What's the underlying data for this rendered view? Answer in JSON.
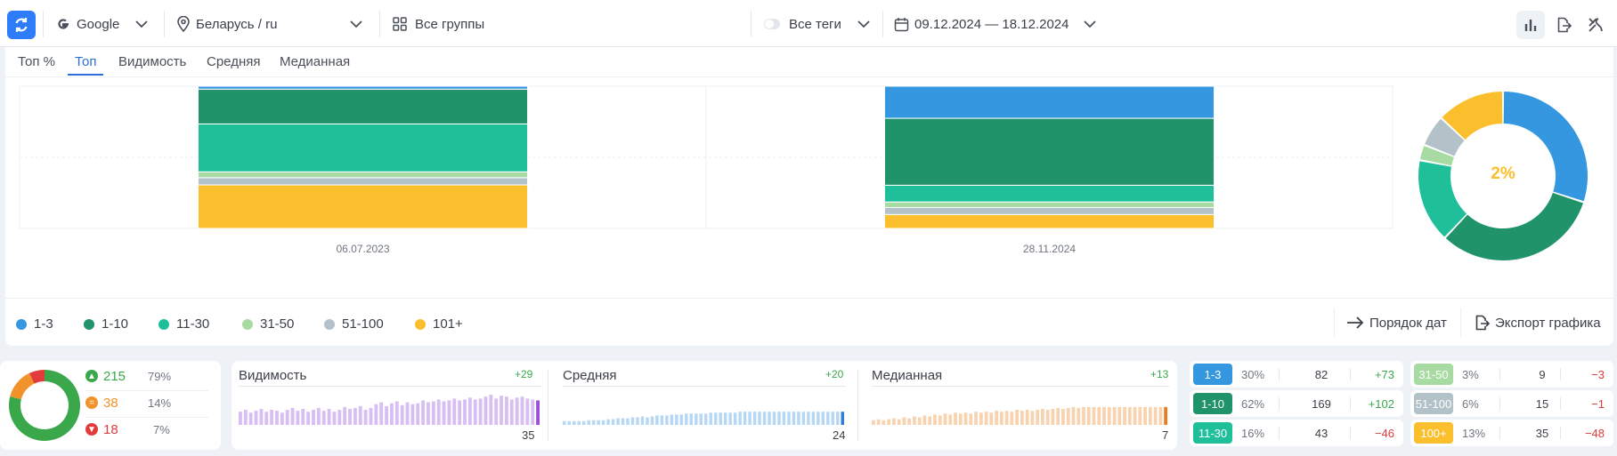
{
  "toolbar": {
    "engine": "Google",
    "region": "Беларусь / ru",
    "groups": "Все группы",
    "tags": "Все теги",
    "date_range": "09.12.2024 — 18.12.2024"
  },
  "tabs": [
    {
      "label": "Топ %",
      "active": false
    },
    {
      "label": "Топ",
      "active": true
    },
    {
      "label": "Видимость",
      "active": false
    },
    {
      "label": "Средняя",
      "active": false
    },
    {
      "label": "Медианная",
      "active": false
    }
  ],
  "chart_data": {
    "type": "bar",
    "stacked": true,
    "categories": [
      "06.07.2023",
      "28.11.2024"
    ],
    "series": [
      {
        "name": "101+",
        "color": "#fbbf2e",
        "values": [
          30,
          10
        ]
      },
      {
        "name": "51-100",
        "color": "#b3c1c8",
        "values": [
          5,
          5
        ]
      },
      {
        "name": "31-50",
        "color": "#a7dba1",
        "values": [
          4,
          4
        ]
      },
      {
        "name": "11-30",
        "color": "#1fbf9a",
        "values": [
          33,
          12
        ]
      },
      {
        "name": "1-10",
        "color": "#21936b",
        "values": [
          24,
          48
        ]
      },
      {
        "name": "1-3",
        "color": "#3497e0",
        "values": [
          2,
          23
        ]
      }
    ],
    "grid": true
  },
  "donut": {
    "center_label": "2%",
    "segments": [
      {
        "name": "1-3",
        "color": "#3497e0",
        "value": 30
      },
      {
        "name": "1-10",
        "color": "#21936b",
        "value": 32
      },
      {
        "name": "11-30",
        "color": "#1fbf9a",
        "value": 16
      },
      {
        "name": "31-50",
        "color": "#a7dba1",
        "value": 3
      },
      {
        "name": "51-100",
        "color": "#b3c1c8",
        "value": 6
      },
      {
        "name": "101+",
        "color": "#fbbf2e",
        "value": 13
      }
    ]
  },
  "legend": [
    {
      "label": "1-3",
      "color": "#3497e0"
    },
    {
      "label": "1-10",
      "color": "#21936b"
    },
    {
      "label": "11-30",
      "color": "#1fbf9a"
    },
    {
      "label": "31-50",
      "color": "#a7dba1"
    },
    {
      "label": "51-100",
      "color": "#b3c1c8"
    },
    {
      "label": "101+",
      "color": "#fbbf2e"
    }
  ],
  "actions": {
    "date_order": "Порядок дат",
    "export_chart": "Экспорт графика"
  },
  "summary": {
    "rows": [
      {
        "value": "215",
        "pct": "79%",
        "color": "#3aa84a",
        "icon": "arrow-up-icon"
      },
      {
        "value": "38",
        "pct": "14%",
        "color": "#f2922a",
        "icon": "equal-icon"
      },
      {
        "value": "18",
        "pct": "7%",
        "color": "#e33b3b",
        "icon": "arrow-down-icon"
      }
    ]
  },
  "sparks": [
    {
      "title": "Видимость",
      "delta": "+29",
      "value": "35",
      "color": "#d8bff3",
      "last": "#9b4fd8",
      "bars": [
        14,
        16,
        13,
        15,
        17,
        14,
        16,
        15,
        13,
        16,
        18,
        15,
        17,
        14,
        16,
        18,
        15,
        17,
        14,
        16,
        19,
        17,
        18,
        20,
        16,
        18,
        22,
        24,
        20,
        23,
        25,
        21,
        24,
        22,
        23,
        26,
        24,
        25,
        27,
        25,
        26,
        28,
        26,
        27,
        29,
        27,
        28,
        30,
        32,
        28,
        31,
        30,
        27,
        29,
        30,
        28,
        27,
        26
      ]
    },
    {
      "title": "Средняя",
      "delta": "+20",
      "value": "24",
      "color": "#b6d8f5",
      "last": "#2b7fd6",
      "bars": [
        4,
        4,
        4,
        4,
        4,
        5,
        5,
        5,
        5,
        6,
        6,
        7,
        7,
        7,
        8,
        8,
        9,
        8,
        9,
        10,
        10,
        10,
        11,
        11,
        11,
        12,
        12,
        12,
        12,
        12,
        13,
        13,
        13,
        13,
        13,
        13,
        14,
        14,
        14,
        14,
        14,
        14,
        14,
        14,
        14,
        14,
        14,
        14,
        14,
        14,
        14,
        14,
        14,
        14,
        14,
        14,
        14,
        14
      ]
    },
    {
      "title": "Медианная",
      "delta": "+13",
      "value": "7",
      "color": "#f7d3b0",
      "last": "#ea7b1e",
      "bars": [
        5,
        6,
        5,
        6,
        7,
        6,
        8,
        7,
        9,
        8,
        10,
        9,
        11,
        10,
        12,
        11,
        13,
        12,
        13,
        12,
        14,
        13,
        14,
        13,
        15,
        14,
        15,
        14,
        16,
        15,
        16,
        15,
        16,
        17,
        16,
        17,
        18,
        17,
        18,
        19,
        18,
        19,
        19,
        19,
        19,
        19,
        19,
        19,
        19,
        19,
        19,
        19,
        19,
        19,
        19,
        19,
        19,
        19
      ]
    }
  ],
  "ranges_left": [
    {
      "label": "1-3",
      "color": "#3497e0",
      "pct": "30%",
      "count": "82",
      "delta": "+73",
      "delta_color": "#3aa84a"
    },
    {
      "label": "1-10",
      "color": "#21936b",
      "pct": "62%",
      "count": "169",
      "delta": "+102",
      "delta_color": "#3aa84a"
    },
    {
      "label": "11-30",
      "color": "#1fbf9a",
      "pct": "16%",
      "count": "43",
      "delta": "−46",
      "delta_color": "#e33b3b"
    }
  ],
  "ranges_right": [
    {
      "label": "31-50",
      "color": "#a7dba1",
      "pct": "3%",
      "count": "9",
      "delta": "−3",
      "delta_color": "#e33b3b"
    },
    {
      "label": "51-100",
      "color": "#b3c1c8",
      "pct": "6%",
      "count": "15",
      "delta": "−1",
      "delta_color": "#e33b3b"
    },
    {
      "label": "100+",
      "color": "#fbbf2e",
      "pct": "13%",
      "count": "35",
      "delta": "−48",
      "delta_color": "#e33b3b"
    }
  ]
}
